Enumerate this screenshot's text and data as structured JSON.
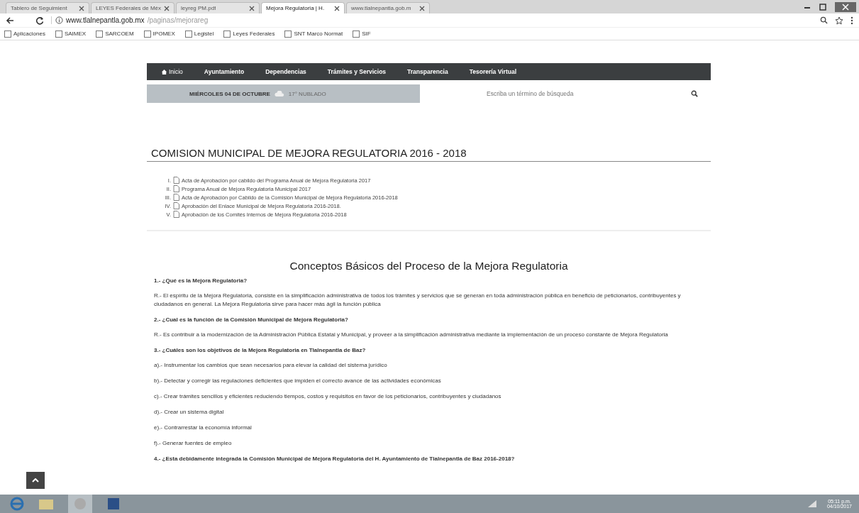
{
  "browser": {
    "tabs": [
      {
        "label": "Tablero de Seguimient",
        "selected": false
      },
      {
        "label": "LEYES Federales de Méx",
        "selected": false
      },
      {
        "label": "leyreg PM.pdf",
        "selected": false
      },
      {
        "label": "Mejora Regulatoria | H.",
        "selected": true
      },
      {
        "label": "www.tlalnepantla.gob.m",
        "selected": false
      }
    ],
    "url_host": "www.tlalnepantla.gob.mx",
    "url_path": "/paginas/mejorareg",
    "bookmarks": [
      "Aplicaciones",
      "SAIMEX",
      "SARCOEM",
      "IPOMEX",
      "Legistel",
      "Leyes Federales",
      "SNT Marco Normat",
      "SIF"
    ]
  },
  "nav": [
    {
      "label": "Inicio",
      "selected": true
    },
    {
      "label": "Ayuntamiento",
      "selected": false
    },
    {
      "label": "Dependencias",
      "selected": false
    },
    {
      "label": "Trámites y Servicios",
      "selected": false
    },
    {
      "label": "Transparencia",
      "selected": false
    },
    {
      "label": "Tesorería Virtual",
      "selected": false
    }
  ],
  "date_bar": {
    "date": "MIÉRCOLES 04 DE OCTUBRE",
    "weather": "17° NUBLADO"
  },
  "search": {
    "placeholder": "Escriba un término de búsqueda"
  },
  "section_title": "COMISION MUNICIPAL DE MEJORA REGULATORIA 2016 - 2018",
  "documents": [
    {
      "numeral": "I.",
      "title": "Acta de Aprobación por cabildo del Programa Anual de Mejora Regulatoria 2017"
    },
    {
      "numeral": "II.",
      "title": "Programa Anual de Mejora Regulatoria Municipal 2017"
    },
    {
      "numeral": "III.",
      "title": "Acta de Aprobación por Cabildo de la Comisión Municipal de Mejora Regulatoria 2016-2018"
    },
    {
      "numeral": "IV.",
      "title": "Aprobación del Enlace Municipal de Mejora Regulatoria 2016-2018."
    },
    {
      "numeral": "V.",
      "title": "Aprobación de los Comités Internos de Mejora Regulatoria 2016-2018"
    }
  ],
  "concepts_title": "Conceptos Básicos del Proceso de la Mejora Regulatoria",
  "concepts": [
    {
      "kind": "question",
      "text": "1.- ¿Qué es la Mejora Regulatoria?"
    },
    {
      "kind": "answer",
      "text": "R.- El espíritu de la Mejora Regulatoria, consiste en la simplificación administrativa de todos los trámites y servicios que se generan en toda administración pública en beneficio de peticionarios, contribuyentes y ciudadanos en general. La Mejora Regulatoria sirve para hacer más ágil la función pública"
    },
    {
      "kind": "question",
      "text": "2.- ¿Cual es la función de la Comisión Municipal de Mejora Regulatoria?"
    },
    {
      "kind": "answer",
      "text": "R.- Es contribuir a la modernización de la Administración Pública Estatal y Municipal, y proveer a la simplificación administrativa mediante la implementación de un proceso constante de Mejora Regulatoria"
    },
    {
      "kind": "question",
      "text": "3.- ¿Cuáles son los objetivos de la Mejora Regulatoria en Tlalnepantla de Baz?"
    },
    {
      "kind": "answer",
      "text": "a).- Instrumentar los cambios que sean necesarios para elevar la calidad del sistema jurídico"
    },
    {
      "kind": "answer",
      "text": "b).- Detectar y corregir las regulaciones deficientes que impiden el correcto avance de las actividades económicas"
    },
    {
      "kind": "answer",
      "text": "c).- Crear trámites sencillos y eficientes reduciendo tiempos, costos y requisitos en favor de los peticionarios, contribuyentes y ciudadanos"
    },
    {
      "kind": "answer",
      "text": "d).- Crear un sistema digital"
    },
    {
      "kind": "answer",
      "text": "e).- Contrarrestar la economía informal"
    },
    {
      "kind": "answer",
      "text": "f).- Generar fuentes de empleo"
    },
    {
      "kind": "question",
      "text": "4.- ¿Esta debidamente integrada la Comisión Municipal de Mejora Regulatoria del H. Ayuntamiento de Tlalnepantla de Baz 2016-2018?"
    }
  ],
  "taskbar": {
    "time": "05:11 p.m.",
    "date": "04/10/2017"
  }
}
